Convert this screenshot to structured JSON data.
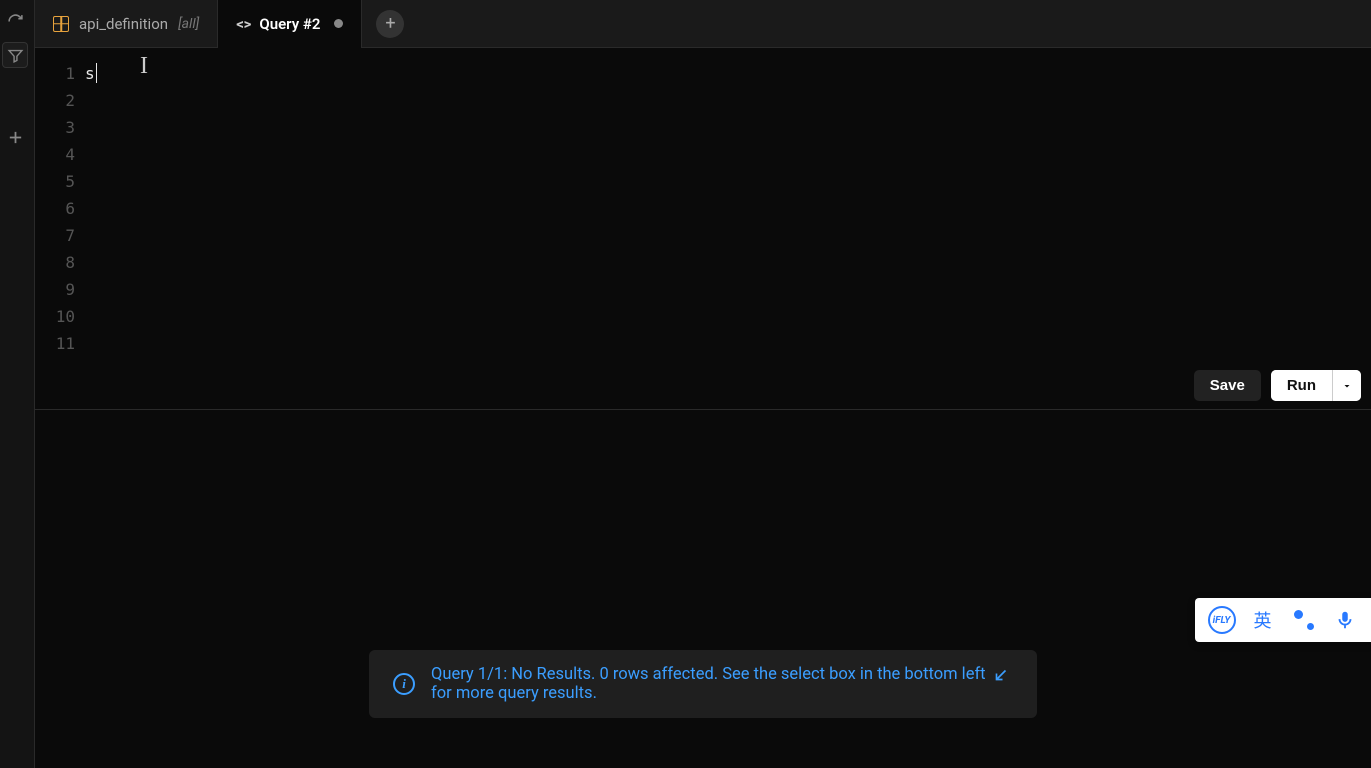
{
  "tabs": [
    {
      "type": "table",
      "label": "api_definition",
      "suffix": "[all]"
    },
    {
      "type": "query",
      "label": "Query #2",
      "dirty": true
    }
  ],
  "editor": {
    "line_count": 11,
    "line1_text": "s"
  },
  "actions": {
    "save_label": "Save",
    "run_label": "Run"
  },
  "toast": {
    "prefix": "Query 1/1: No Results. 0 rows affected. See the select box in the bottom left",
    "suffix": "for more query results."
  },
  "ime": {
    "logo_text": "iFLY",
    "lang_char": "英"
  }
}
